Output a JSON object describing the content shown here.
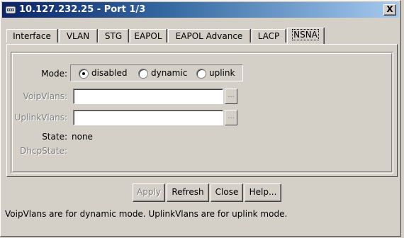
{
  "window": {
    "title": "10.127.232.25 - Port 1/3",
    "close_label": "X"
  },
  "tabs": [
    {
      "label": "Interface"
    },
    {
      "label": "VLAN"
    },
    {
      "label": "STG"
    },
    {
      "label": "EAPOL"
    },
    {
      "label": "EAPOL Advance"
    },
    {
      "label": "LACP"
    },
    {
      "label": "NSNA",
      "active": true
    }
  ],
  "form": {
    "mode_label": "Mode:",
    "mode_options": [
      {
        "label": "disabled",
        "selected": true
      },
      {
        "label": "dynamic",
        "selected": false
      },
      {
        "label": "uplink",
        "selected": false
      }
    ],
    "voip_vlans_label": "VoipVlans:",
    "voip_vlans_value": "",
    "uplink_vlans_label": "UplinkVlans:",
    "uplink_vlans_value": "",
    "ellipsis_label": "...",
    "state_label": "State:",
    "state_value": "none",
    "dhcp_state_label": "DhcpState:",
    "dhcp_state_value": ""
  },
  "buttons": {
    "apply": "Apply",
    "refresh": "Refresh",
    "close": "Close",
    "help": "Help..."
  },
  "status_note": "VoipVlans are for dynamic mode.  UplinkVlans are for uplink mode.",
  "colors": {
    "titlebar_start": "#0a246a",
    "titlebar_end": "#a6caf0",
    "face": "#d4d0c8"
  },
  "icons": {
    "app": "network-device-icon",
    "close": "close-icon"
  }
}
